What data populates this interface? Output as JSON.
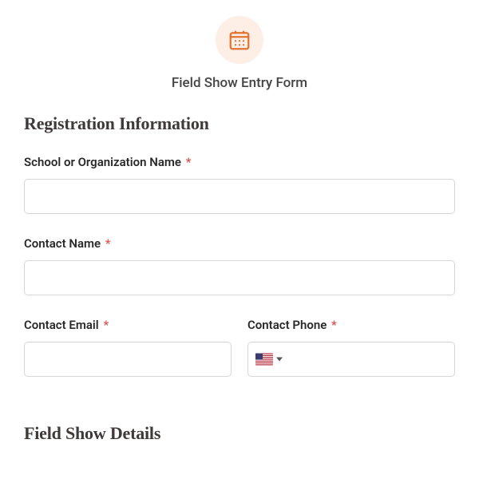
{
  "header": {
    "title": "Field Show Entry Form",
    "icon": "calendar-icon"
  },
  "sections": {
    "registration": {
      "heading": "Registration Information",
      "fields": {
        "orgName": {
          "label": "School or Organization Name",
          "required": true,
          "value": ""
        },
        "contactName": {
          "label": "Contact Name",
          "required": true,
          "value": ""
        },
        "contactEmail": {
          "label": "Contact Email",
          "required": true,
          "value": ""
        },
        "contactPhone": {
          "label": "Contact Phone",
          "required": true,
          "value": "",
          "country": "US"
        }
      }
    },
    "details": {
      "heading": "Field Show Details"
    }
  },
  "required_marker": "*"
}
